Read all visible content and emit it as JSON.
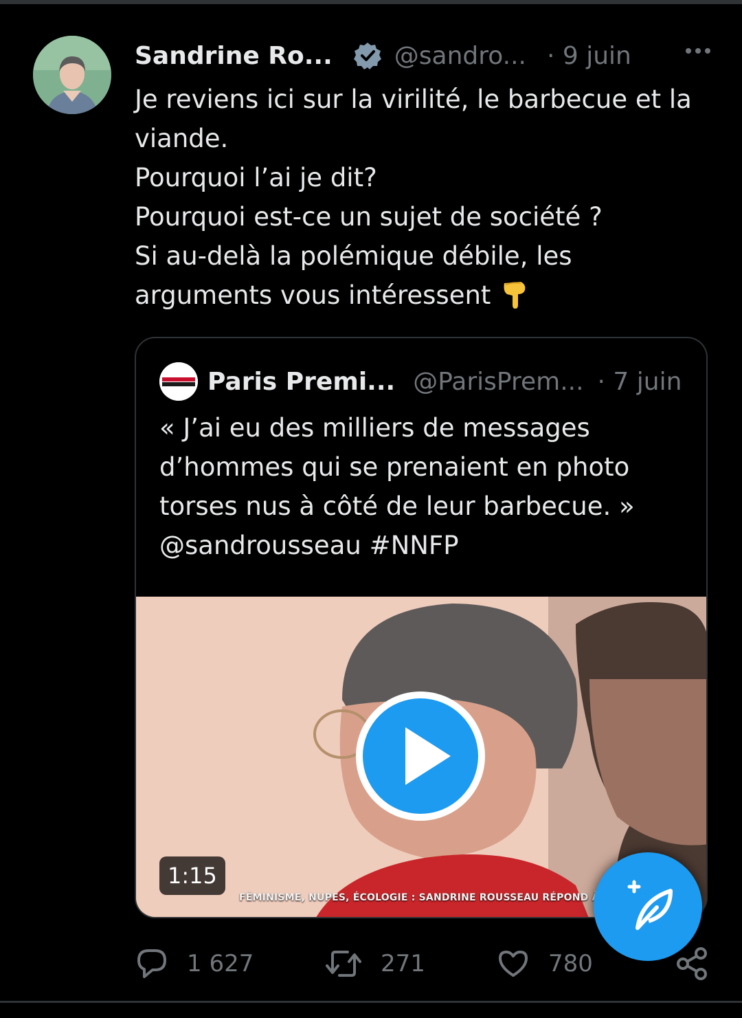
{
  "tweet": {
    "author_name": "Sandrine Ro...",
    "handle": "@sandro...",
    "date": "· 9 juin",
    "text_lines": [
      "Je reviens ici sur la virilité, le barbecue et la",
      "viande.",
      "Pourquoi l’ai je dit?",
      "Pourquoi est-ce un sujet de société ?",
      "Si au-delà la polémique débile, les",
      "arguments vous intéressent"
    ],
    "emoji": "👇"
  },
  "quote": {
    "author_name": "Paris Premi...",
    "handle": "@ParisPrem...",
    "date": "· 7 juin",
    "text_lines": [
      "« J’ai eu des milliers de messages",
      "d’hommes qui se prenaient en photo",
      "torses nus à côté de leur barbecue. »",
      "@sandrousseau #NNFP"
    ],
    "video": {
      "duration": "1:15",
      "caption": "FÉMINISME, NUPES, ÉCOLOGIE : SANDRINE ROUSSEAU RÉPOND À NO"
    }
  },
  "actions": {
    "replies": "1 627",
    "retweets": "271",
    "likes": "780"
  },
  "colors": {
    "background": "#000000",
    "text": "#e7e9ea",
    "secondary_text": "#71767b",
    "accent": "#1d9bf0",
    "border": "#2f3336"
  },
  "icons": {
    "verified": "verified-badge-icon",
    "more": "more-dots-icon",
    "play": "play-icon",
    "compose": "compose-feather-icon",
    "reply": "reply-bubble-icon",
    "retweet": "retweet-icon",
    "like": "heart-icon",
    "share": "share-icon"
  }
}
